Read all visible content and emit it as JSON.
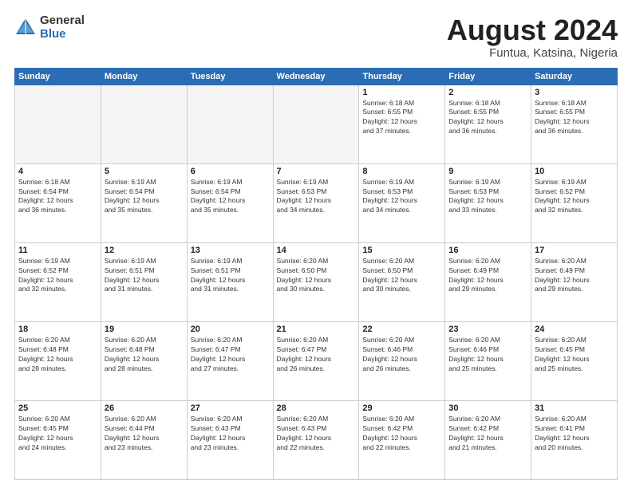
{
  "header": {
    "logo_general": "General",
    "logo_blue": "Blue",
    "month_title": "August 2024",
    "location": "Funtua, Katsina, Nigeria"
  },
  "weekdays": [
    "Sunday",
    "Monday",
    "Tuesday",
    "Wednesday",
    "Thursday",
    "Friday",
    "Saturday"
  ],
  "weeks": [
    [
      {
        "day": "",
        "detail": ""
      },
      {
        "day": "",
        "detail": ""
      },
      {
        "day": "",
        "detail": ""
      },
      {
        "day": "",
        "detail": ""
      },
      {
        "day": "1",
        "detail": "Sunrise: 6:18 AM\nSunset: 6:55 PM\nDaylight: 12 hours\nand 37 minutes."
      },
      {
        "day": "2",
        "detail": "Sunrise: 6:18 AM\nSunset: 6:55 PM\nDaylight: 12 hours\nand 36 minutes."
      },
      {
        "day": "3",
        "detail": "Sunrise: 6:18 AM\nSunset: 6:55 PM\nDaylight: 12 hours\nand 36 minutes."
      }
    ],
    [
      {
        "day": "4",
        "detail": "Sunrise: 6:18 AM\nSunset: 6:54 PM\nDaylight: 12 hours\nand 36 minutes."
      },
      {
        "day": "5",
        "detail": "Sunrise: 6:19 AM\nSunset: 6:54 PM\nDaylight: 12 hours\nand 35 minutes."
      },
      {
        "day": "6",
        "detail": "Sunrise: 6:19 AM\nSunset: 6:54 PM\nDaylight: 12 hours\nand 35 minutes."
      },
      {
        "day": "7",
        "detail": "Sunrise: 6:19 AM\nSunset: 6:53 PM\nDaylight: 12 hours\nand 34 minutes."
      },
      {
        "day": "8",
        "detail": "Sunrise: 6:19 AM\nSunset: 6:53 PM\nDaylight: 12 hours\nand 34 minutes."
      },
      {
        "day": "9",
        "detail": "Sunrise: 6:19 AM\nSunset: 6:53 PM\nDaylight: 12 hours\nand 33 minutes."
      },
      {
        "day": "10",
        "detail": "Sunrise: 6:19 AM\nSunset: 6:52 PM\nDaylight: 12 hours\nand 32 minutes."
      }
    ],
    [
      {
        "day": "11",
        "detail": "Sunrise: 6:19 AM\nSunset: 6:52 PM\nDaylight: 12 hours\nand 32 minutes."
      },
      {
        "day": "12",
        "detail": "Sunrise: 6:19 AM\nSunset: 6:51 PM\nDaylight: 12 hours\nand 31 minutes."
      },
      {
        "day": "13",
        "detail": "Sunrise: 6:19 AM\nSunset: 6:51 PM\nDaylight: 12 hours\nand 31 minutes."
      },
      {
        "day": "14",
        "detail": "Sunrise: 6:20 AM\nSunset: 6:50 PM\nDaylight: 12 hours\nand 30 minutes."
      },
      {
        "day": "15",
        "detail": "Sunrise: 6:20 AM\nSunset: 6:50 PM\nDaylight: 12 hours\nand 30 minutes."
      },
      {
        "day": "16",
        "detail": "Sunrise: 6:20 AM\nSunset: 6:49 PM\nDaylight: 12 hours\nand 29 minutes."
      },
      {
        "day": "17",
        "detail": "Sunrise: 6:20 AM\nSunset: 6:49 PM\nDaylight: 12 hours\nand 29 minutes."
      }
    ],
    [
      {
        "day": "18",
        "detail": "Sunrise: 6:20 AM\nSunset: 6:48 PM\nDaylight: 12 hours\nand 28 minutes."
      },
      {
        "day": "19",
        "detail": "Sunrise: 6:20 AM\nSunset: 6:48 PM\nDaylight: 12 hours\nand 28 minutes."
      },
      {
        "day": "20",
        "detail": "Sunrise: 6:20 AM\nSunset: 6:47 PM\nDaylight: 12 hours\nand 27 minutes."
      },
      {
        "day": "21",
        "detail": "Sunrise: 6:20 AM\nSunset: 6:47 PM\nDaylight: 12 hours\nand 26 minutes."
      },
      {
        "day": "22",
        "detail": "Sunrise: 6:20 AM\nSunset: 6:46 PM\nDaylight: 12 hours\nand 26 minutes."
      },
      {
        "day": "23",
        "detail": "Sunrise: 6:20 AM\nSunset: 6:46 PM\nDaylight: 12 hours\nand 25 minutes."
      },
      {
        "day": "24",
        "detail": "Sunrise: 6:20 AM\nSunset: 6:45 PM\nDaylight: 12 hours\nand 25 minutes."
      }
    ],
    [
      {
        "day": "25",
        "detail": "Sunrise: 6:20 AM\nSunset: 6:45 PM\nDaylight: 12 hours\nand 24 minutes."
      },
      {
        "day": "26",
        "detail": "Sunrise: 6:20 AM\nSunset: 6:44 PM\nDaylight: 12 hours\nand 23 minutes."
      },
      {
        "day": "27",
        "detail": "Sunrise: 6:20 AM\nSunset: 6:43 PM\nDaylight: 12 hours\nand 23 minutes."
      },
      {
        "day": "28",
        "detail": "Sunrise: 6:20 AM\nSunset: 6:43 PM\nDaylight: 12 hours\nand 22 minutes."
      },
      {
        "day": "29",
        "detail": "Sunrise: 6:20 AM\nSunset: 6:42 PM\nDaylight: 12 hours\nand 22 minutes."
      },
      {
        "day": "30",
        "detail": "Sunrise: 6:20 AM\nSunset: 6:42 PM\nDaylight: 12 hours\nand 21 minutes."
      },
      {
        "day": "31",
        "detail": "Sunrise: 6:20 AM\nSunset: 6:41 PM\nDaylight: 12 hours\nand 20 minutes."
      }
    ]
  ]
}
